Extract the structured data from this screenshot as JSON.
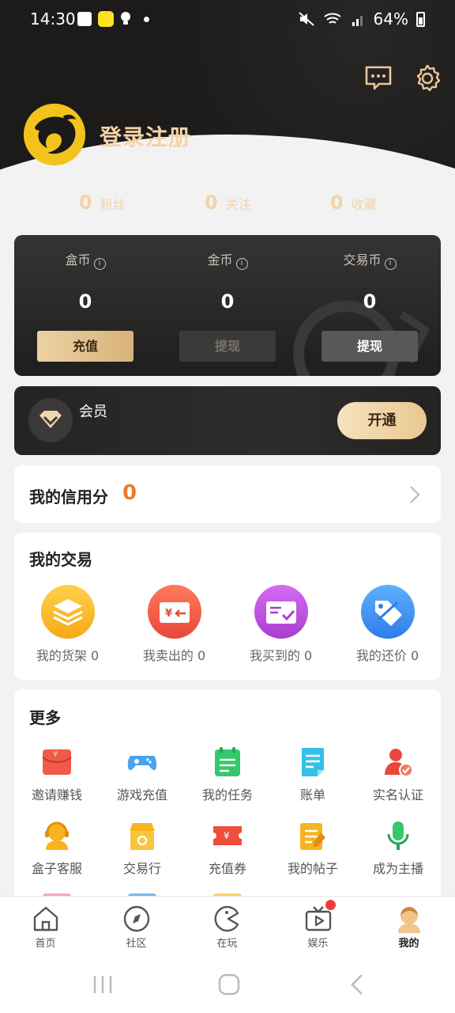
{
  "status_bar": {
    "time": "14:30",
    "battery": "64%"
  },
  "profile": {
    "login_label": "登录注册",
    "stats": [
      {
        "value": "0",
        "label": "粉丝"
      },
      {
        "value": "0",
        "label": "关注"
      },
      {
        "value": "0",
        "label": "收藏"
      }
    ]
  },
  "wallet": {
    "columns": [
      {
        "label": "盒币",
        "value": "0",
        "button": "充值"
      },
      {
        "label": "金币",
        "value": "0",
        "button": "提现"
      },
      {
        "label": "交易币",
        "value": "0",
        "button": "提现"
      }
    ]
  },
  "member": {
    "label": "会员",
    "button": "开通"
  },
  "credit": {
    "title": "我的信用分",
    "value": "0"
  },
  "trade": {
    "title": "我的交易",
    "items": [
      {
        "label": "我的货架 0",
        "icon": "shelf-icon",
        "color": "#f8b82a"
      },
      {
        "label": "我卖出的 0",
        "icon": "sold-icon",
        "color": "#ee5a45"
      },
      {
        "label": "我买到的 0",
        "icon": "bought-icon",
        "color": "#b64ad8"
      },
      {
        "label": "我的还价 0",
        "icon": "bargain-icon",
        "color": "#3f8ef0"
      }
    ]
  },
  "more": {
    "title": "更多",
    "items": [
      {
        "label": "邀请赚钱",
        "icon": "invite-icon",
        "color": "#ec4a3c"
      },
      {
        "label": "游戏充值",
        "icon": "gamepad-icon",
        "color": "#3e9bea"
      },
      {
        "label": "我的任务",
        "icon": "task-icon",
        "color": "#33c46b"
      },
      {
        "label": "账单",
        "icon": "bill-icon",
        "color": "#2fb8e5"
      },
      {
        "label": "实名认证",
        "icon": "verify-icon",
        "color": "#e84a3c"
      },
      {
        "label": "盒子客服",
        "icon": "support-icon",
        "color": "#f6b21e"
      },
      {
        "label": "交易行",
        "icon": "market-icon",
        "color": "#f6b21e"
      },
      {
        "label": "充值券",
        "icon": "coupon-icon",
        "color": "#ec4a3c"
      },
      {
        "label": "我的帖子",
        "icon": "post-icon",
        "color": "#f6b21e"
      },
      {
        "label": "成为主播",
        "icon": "mic-icon",
        "color": "#33c46b"
      }
    ]
  },
  "bottom_nav": {
    "items": [
      {
        "label": "首页",
        "icon": "home-icon"
      },
      {
        "label": "社区",
        "icon": "compass-icon"
      },
      {
        "label": "在玩",
        "icon": "pacman-icon"
      },
      {
        "label": "娱乐",
        "icon": "tv-icon"
      },
      {
        "label": "我的",
        "icon": "profile-icon"
      }
    ]
  }
}
